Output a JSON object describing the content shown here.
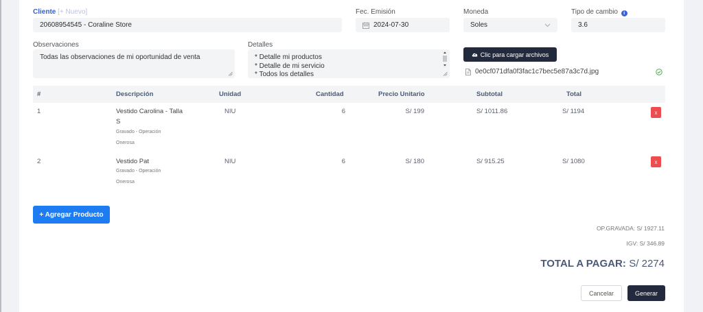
{
  "form": {
    "cliente_label": "Cliente",
    "nuevo_label": "[+ Nuevo]",
    "cliente_value": "20608954545 - Coraline Store",
    "fecha_label": "Fec. Emisión",
    "fecha_value": "2024-07-30",
    "moneda_label": "Moneda",
    "moneda_value": "Soles",
    "tipo_cambio_label": "Tipo de cambio",
    "tipo_cambio_value": "3.6",
    "observaciones_label": "Observaciones",
    "observaciones_value": "Todas las observaciones de mi oportunidad de venta",
    "detalles_label": "Detalles",
    "detalles_lines": [
      "* Detalle mi productos",
      "* Detalle de mi servicio",
      "* Todos los detalles"
    ],
    "upload_button": "Clic para cargar archivos",
    "file_name": "0e0cf071dfa0f3fac1c7bec5e87a3c7d.jpg"
  },
  "table": {
    "headers": {
      "num": "#",
      "descripcion": "Descripción",
      "unidad": "Unidad",
      "cantidad": "Cantidad",
      "precio": "Precio Unitario",
      "subtotal": "Subtotal",
      "total": "Total"
    },
    "rows": [
      {
        "num": "1",
        "desc_line1": "Vestido Carolina - Talla",
        "desc_line2": "S",
        "sub_line1": "Gravado - Operación",
        "sub_line2": "Onerosa",
        "unidad": "NIU",
        "cantidad": "6",
        "precio": "S/ 199",
        "subtotal": "S/ 1011.86",
        "total": "S/ 1194",
        "delete": "x"
      },
      {
        "num": "2",
        "desc_line1": "Vestido Pat",
        "sub_line1": "Gravado - Operación",
        "sub_line2": "Onerosa",
        "unidad": "NIU",
        "cantidad": "6",
        "precio": "S/ 180",
        "subtotal": "S/ 915.25",
        "total": "S/ 1080",
        "delete": "x"
      }
    ]
  },
  "add_product_button": "+ Agregar Producto",
  "totals": {
    "op_gravada": "OP.GRAVADA: S/ 1927.11",
    "igv": "IGV: S/ 346.89",
    "total_label": "TOTAL A PAGAR:",
    "total_value": "S/ 2274"
  },
  "actions": {
    "cancel": "Cancelar",
    "generate": "Generar"
  },
  "colors": {
    "primary_blue": "#1e7cf2",
    "dark_button": "#242a3d",
    "danger": "#ef4d4d",
    "success": "#4caf50"
  }
}
